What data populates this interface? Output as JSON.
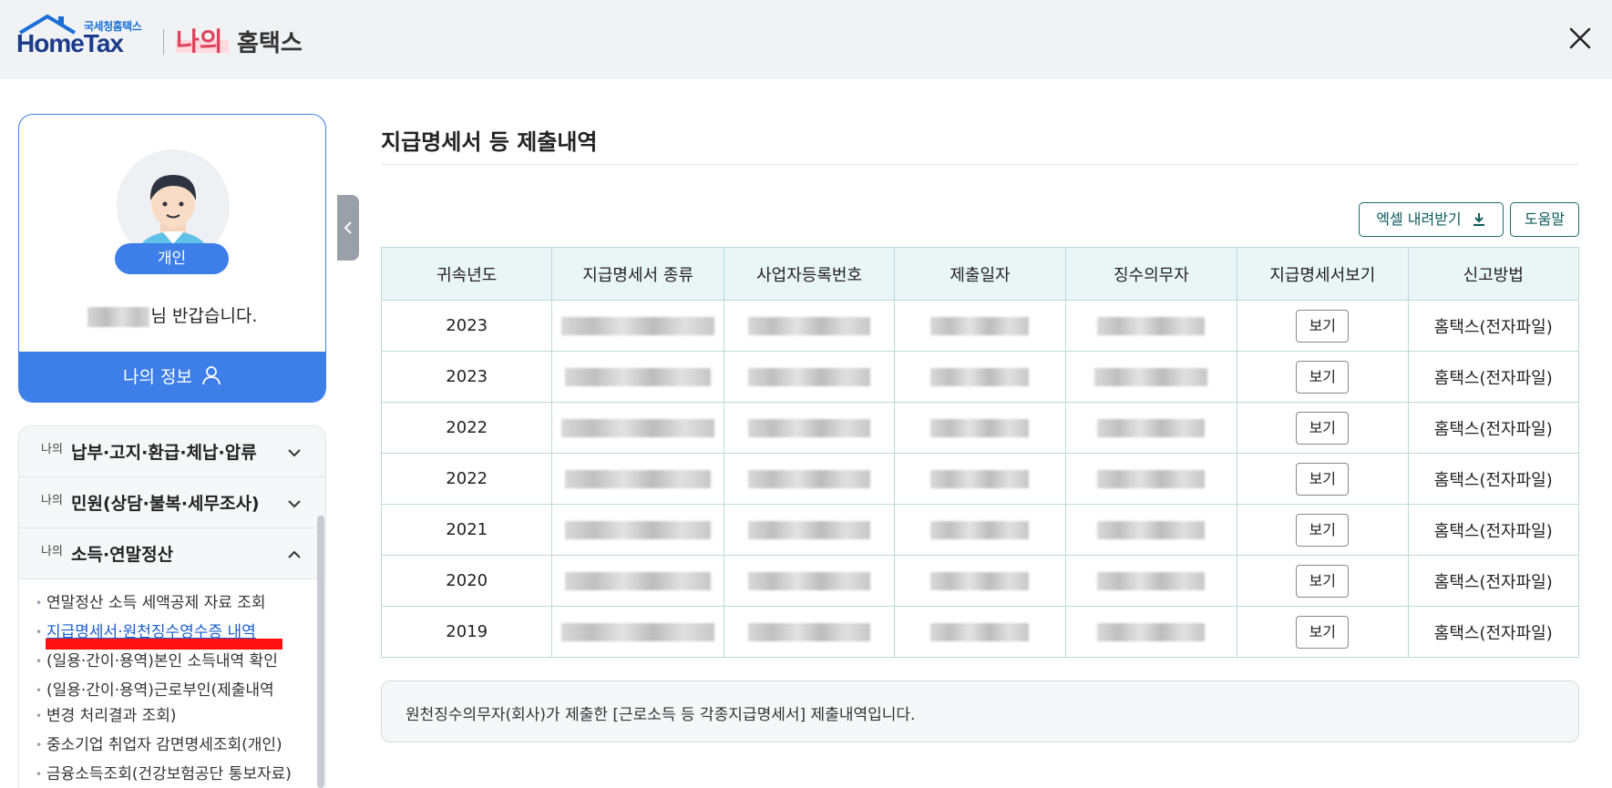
{
  "header": {
    "logo_small": "국세청홈택스",
    "logo_main": "HomeTax",
    "logo_nai": "나의",
    "logo_hometax": "홈택스"
  },
  "profile": {
    "badge": "개인",
    "greeting_suffix": "님 반갑습니다.",
    "myinfo_label": "나의 정보"
  },
  "sidebar": {
    "sections": [
      {
        "prefix": "나의",
        "title": "납부·고지·환급·체납·압류",
        "expanded": false
      },
      {
        "prefix": "나의",
        "title": "민원(상담·불복·세무조사)",
        "expanded": false
      },
      {
        "prefix": "나의",
        "title": "소득·연말정산",
        "expanded": true
      }
    ],
    "sub_items": [
      "연말정산 소득 세액공제 자료 조회",
      "지급명세서·원천징수영수증 내역",
      "(일용·간이·용역)본인 소득내역 확인",
      "(일용·간이·용역)근로부인(제출내역",
      "변경 처리결과 조회)",
      "중소기업 취업자 감면명세조회(개인)",
      "금융소득조회(건강보험공단 통보자료)"
    ]
  },
  "main": {
    "title": "지급명세서 등 제출내역",
    "excel_label": "엑셀 내려받기",
    "help_label": "도움말",
    "columns": [
      "귀속년도",
      "지급명세서 종류",
      "사업자등록번호",
      "제출일자",
      "징수의무자",
      "지급명세서보기",
      "신고방법"
    ],
    "rows": [
      {
        "year": "2023",
        "view": "보기",
        "method": "홈택스(전자파일)"
      },
      {
        "year": "2023",
        "view": "보기",
        "method": "홈택스(전자파일)"
      },
      {
        "year": "2022",
        "view": "보기",
        "method": "홈택스(전자파일)"
      },
      {
        "year": "2022",
        "view": "보기",
        "method": "홈택스(전자파일)"
      },
      {
        "year": "2021",
        "view": "보기",
        "method": "홈택스(전자파일)"
      },
      {
        "year": "2020",
        "view": "보기",
        "method": "홈택스(전자파일)"
      },
      {
        "year": "2019",
        "view": "보기",
        "method": "홈택스(전자파일)"
      }
    ],
    "notice": "원천징수의무자(회사)가 제출한 [근로소득 등 각종지급명세서] 제출내역입니다."
  },
  "colors": {
    "primary": "#3d7ee8",
    "teal_border": "#1b6b6b",
    "table_header_bg": "#eaf5f5",
    "highlight_red": "#ff1111",
    "link_blue": "#1b5fcf"
  },
  "icons": [
    "close-icon",
    "user-icon",
    "chevron-down-icon",
    "chevron-up-icon",
    "chevron-left-icon",
    "download-icon"
  ]
}
